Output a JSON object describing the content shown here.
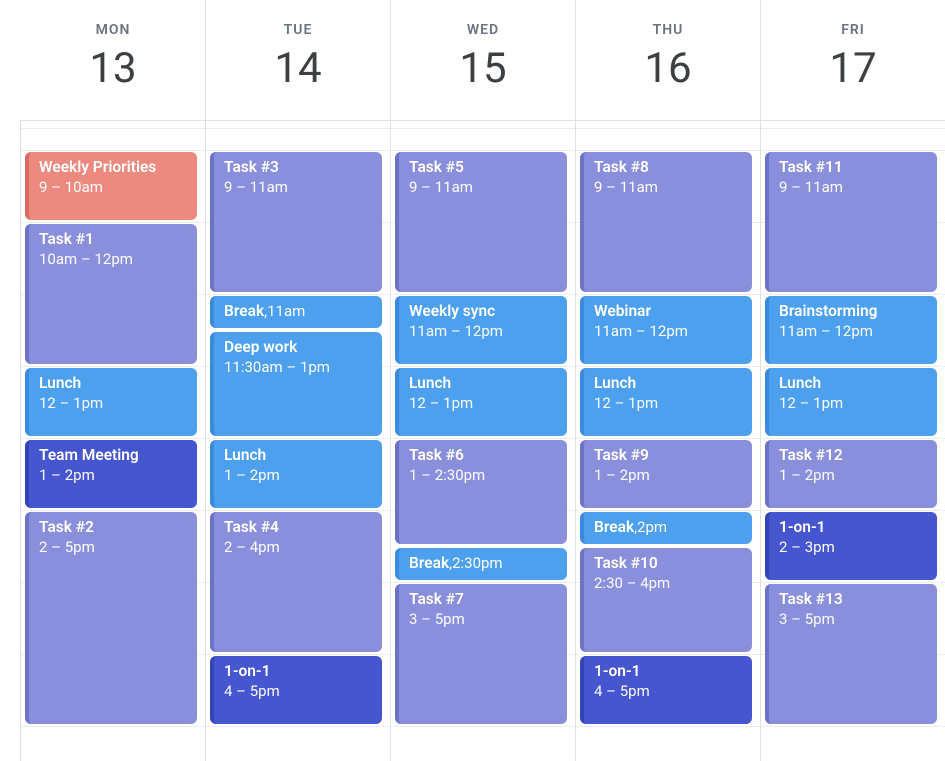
{
  "days": [
    {
      "abbr": "MON",
      "num": "13"
    },
    {
      "abbr": "TUE",
      "num": "14"
    },
    {
      "abbr": "WED",
      "num": "15"
    },
    {
      "abbr": "THU",
      "num": "16"
    },
    {
      "abbr": "FRI",
      "num": "17"
    }
  ],
  "grid": {
    "startHour": 8.6,
    "endHour": 17.4,
    "hourHeight": 72
  },
  "colors": {
    "red": "#ec8a80",
    "purple": "#8a8fdc",
    "blue": "#4da0ee",
    "navy": "#4556cf"
  },
  "events": [
    {
      "day": 0,
      "title": "Weekly Priorities",
      "time": "9 – 10am",
      "start": 9.0,
      "end": 10.0,
      "color": "red"
    },
    {
      "day": 0,
      "title": "Task #1",
      "time": "10am – 12pm",
      "start": 10.0,
      "end": 12.0,
      "color": "purple"
    },
    {
      "day": 0,
      "title": "Lunch",
      "time": "12 – 1pm",
      "start": 12.0,
      "end": 13.0,
      "color": "blue"
    },
    {
      "day": 0,
      "title": "Team Meeting",
      "time": "1 – 2pm",
      "start": 13.0,
      "end": 14.0,
      "color": "navy"
    },
    {
      "day": 0,
      "title": "Task #2",
      "time": "2 – 5pm",
      "start": 14.0,
      "end": 17.0,
      "color": "purple"
    },
    {
      "day": 1,
      "title": "Task #3",
      "time": "9 – 11am",
      "start": 9.0,
      "end": 11.0,
      "color": "purple"
    },
    {
      "day": 1,
      "title": "Break",
      "time": "11am",
      "start": 11.0,
      "end": 11.5,
      "color": "blue",
      "compact": true
    },
    {
      "day": 1,
      "title": "Deep work",
      "time": "11:30am – 1pm",
      "start": 11.5,
      "end": 13.0,
      "color": "blue"
    },
    {
      "day": 1,
      "title": "Lunch",
      "time": "1 – 2pm",
      "start": 13.0,
      "end": 14.0,
      "color": "blue"
    },
    {
      "day": 1,
      "title": "Task #4",
      "time": "2 – 4pm",
      "start": 14.0,
      "end": 16.0,
      "color": "purple"
    },
    {
      "day": 1,
      "title": "1-on-1",
      "time": "4 – 5pm",
      "start": 16.0,
      "end": 17.0,
      "color": "navy"
    },
    {
      "day": 2,
      "title": "Task #5",
      "time": "9 – 11am",
      "start": 9.0,
      "end": 11.0,
      "color": "purple"
    },
    {
      "day": 2,
      "title": "Weekly sync",
      "time": "11am – 12pm",
      "start": 11.0,
      "end": 12.0,
      "color": "blue"
    },
    {
      "day": 2,
      "title": "Lunch",
      "time": "12 – 1pm",
      "start": 12.0,
      "end": 13.0,
      "color": "blue"
    },
    {
      "day": 2,
      "title": "Task #6",
      "time": "1 – 2:30pm",
      "start": 13.0,
      "end": 14.5,
      "color": "purple"
    },
    {
      "day": 2,
      "title": "Break",
      "time": "2:30pm",
      "start": 14.5,
      "end": 15.0,
      "color": "blue",
      "compact": true
    },
    {
      "day": 2,
      "title": "Task #7",
      "time": "3 – 5pm",
      "start": 15.0,
      "end": 17.0,
      "color": "purple"
    },
    {
      "day": 3,
      "title": "Task #8",
      "time": "9 – 11am",
      "start": 9.0,
      "end": 11.0,
      "color": "purple"
    },
    {
      "day": 3,
      "title": "Webinar",
      "time": "11am – 12pm",
      "start": 11.0,
      "end": 12.0,
      "color": "blue"
    },
    {
      "day": 3,
      "title": "Lunch",
      "time": "12 – 1pm",
      "start": 12.0,
      "end": 13.0,
      "color": "blue"
    },
    {
      "day": 3,
      "title": "Task #9",
      "time": "1 – 2pm",
      "start": 13.0,
      "end": 14.0,
      "color": "purple"
    },
    {
      "day": 3,
      "title": "Break",
      "time": "2pm",
      "start": 14.0,
      "end": 14.5,
      "color": "blue",
      "compact": true
    },
    {
      "day": 3,
      "title": "Task #10",
      "time": "2:30 – 4pm",
      "start": 14.5,
      "end": 16.0,
      "color": "purple"
    },
    {
      "day": 3,
      "title": "1-on-1",
      "time": "4 – 5pm",
      "start": 16.0,
      "end": 17.0,
      "color": "navy"
    },
    {
      "day": 4,
      "title": "Task #11",
      "time": "9 – 11am",
      "start": 9.0,
      "end": 11.0,
      "color": "purple"
    },
    {
      "day": 4,
      "title": "Brainstorming",
      "time": "11am – 12pm",
      "start": 11.0,
      "end": 12.0,
      "color": "blue"
    },
    {
      "day": 4,
      "title": "Lunch",
      "time": "12 – 1pm",
      "start": 12.0,
      "end": 13.0,
      "color": "blue"
    },
    {
      "day": 4,
      "title": "Task #12",
      "time": "1 – 2pm",
      "start": 13.0,
      "end": 14.0,
      "color": "purple"
    },
    {
      "day": 4,
      "title": "1-on-1",
      "time": "2 – 3pm",
      "start": 14.0,
      "end": 15.0,
      "color": "navy"
    },
    {
      "day": 4,
      "title": "Task #13",
      "time": "3 – 5pm",
      "start": 15.0,
      "end": 17.0,
      "color": "purple"
    }
  ]
}
